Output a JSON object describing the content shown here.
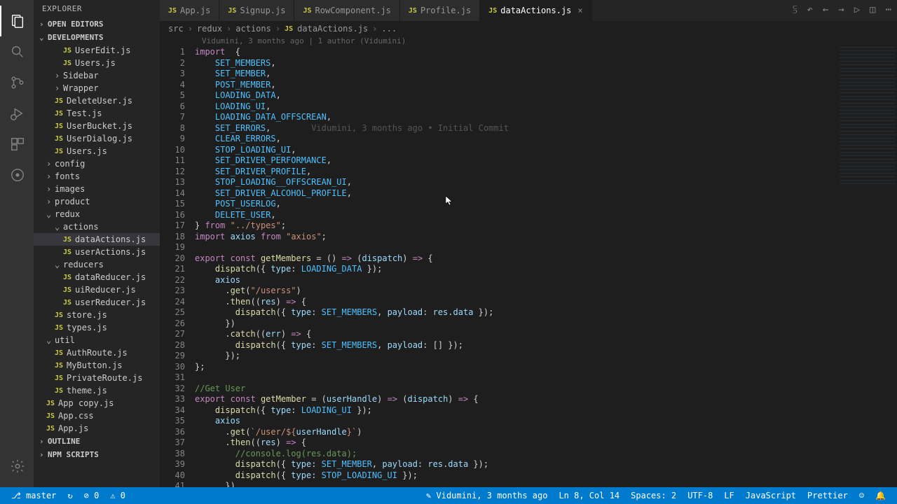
{
  "sidebar": {
    "title": "EXPLORER",
    "sections": {
      "openEditors": "OPEN EDITORS",
      "workspace": "DEVELOPMENTS",
      "outline": "OUTLINE",
      "npm": "NPM SCRIPTS"
    },
    "tree": [
      {
        "type": "file",
        "name": "UserEdit.js",
        "indent": 2
      },
      {
        "type": "file",
        "name": "Users.js",
        "indent": 2
      },
      {
        "type": "folder",
        "name": "Sidebar",
        "indent": 1,
        "open": false
      },
      {
        "type": "folder",
        "name": "Wrapper",
        "indent": 1,
        "open": false
      },
      {
        "type": "file",
        "name": "DeleteUser.js",
        "indent": 1
      },
      {
        "type": "file",
        "name": "Test.js",
        "indent": 1
      },
      {
        "type": "file",
        "name": "UserBucket.js",
        "indent": 1
      },
      {
        "type": "file",
        "name": "UserDialog.js",
        "indent": 1
      },
      {
        "type": "file",
        "name": "Users.js",
        "indent": 1
      },
      {
        "type": "folder",
        "name": "config",
        "indent": 0,
        "open": false
      },
      {
        "type": "folder",
        "name": "fonts",
        "indent": 0,
        "open": false
      },
      {
        "type": "folder",
        "name": "images",
        "indent": 0,
        "open": false
      },
      {
        "type": "folder",
        "name": "product",
        "indent": 0,
        "open": false
      },
      {
        "type": "folder",
        "name": "redux",
        "indent": 0,
        "open": true
      },
      {
        "type": "folder",
        "name": "actions",
        "indent": 1,
        "open": true
      },
      {
        "type": "file",
        "name": "dataActions.js",
        "indent": 2,
        "selected": true
      },
      {
        "type": "file",
        "name": "userActions.js",
        "indent": 2
      },
      {
        "type": "folder",
        "name": "reducers",
        "indent": 1,
        "open": true
      },
      {
        "type": "file",
        "name": "dataReducer.js",
        "indent": 2
      },
      {
        "type": "file",
        "name": "uiReducer.js",
        "indent": 2
      },
      {
        "type": "file",
        "name": "userReducer.js",
        "indent": 2
      },
      {
        "type": "file",
        "name": "store.js",
        "indent": 1
      },
      {
        "type": "file",
        "name": "types.js",
        "indent": 1
      },
      {
        "type": "folder",
        "name": "util",
        "indent": 0,
        "open": true
      },
      {
        "type": "file",
        "name": "AuthRoute.js",
        "indent": 1
      },
      {
        "type": "file",
        "name": "MyButton.js",
        "indent": 1
      },
      {
        "type": "file",
        "name": "PrivateRoute.js",
        "indent": 1
      },
      {
        "type": "file",
        "name": "theme.js",
        "indent": 1
      },
      {
        "type": "file",
        "name": "App copy.js",
        "indent": 0
      },
      {
        "type": "file",
        "name": "App.css",
        "indent": 0
      },
      {
        "type": "file",
        "name": "App.js",
        "indent": 0
      }
    ]
  },
  "tabs": [
    {
      "label": "App.js",
      "active": false
    },
    {
      "label": "Signup.js",
      "active": false
    },
    {
      "label": "RowComponent.js",
      "active": false
    },
    {
      "label": "Profile.js",
      "active": false
    },
    {
      "label": "dataActions.js",
      "active": true
    }
  ],
  "breadcrumb": [
    "src",
    "redux",
    "actions",
    "dataActions.js",
    "..."
  ],
  "blameHeader": "Vidumini, 3 months ago | 1 author (Vidumini)",
  "inlineBlame": "Vidumini, 3 months ago • Initial Commit",
  "code": {
    "lines": [
      [
        [
          "kw",
          "import"
        ],
        [
          "punct",
          "  {"
        ]
      ],
      [
        [
          "punct",
          "    "
        ],
        [
          "const-name",
          "SET_MEMBERS"
        ],
        [
          "punct",
          ","
        ]
      ],
      [
        [
          "punct",
          "    "
        ],
        [
          "const-name",
          "SET_MEMBER"
        ],
        [
          "punct",
          ","
        ]
      ],
      [
        [
          "punct",
          "    "
        ],
        [
          "const-name",
          "POST_MEMBER"
        ],
        [
          "punct",
          ","
        ]
      ],
      [
        [
          "punct",
          "    "
        ],
        [
          "const-name",
          "LOADING_DATA"
        ],
        [
          "punct",
          ","
        ]
      ],
      [
        [
          "punct",
          "    "
        ],
        [
          "const-name",
          "LOADING_UI"
        ],
        [
          "punct",
          ","
        ]
      ],
      [
        [
          "punct",
          "    "
        ],
        [
          "const-name",
          "LOADING_DATA_OFFSCREAN"
        ],
        [
          "punct",
          ","
        ]
      ],
      [
        [
          "punct",
          "    "
        ],
        [
          "const-name",
          "SET_ERRORS"
        ],
        [
          "punct",
          ","
        ],
        [
          "blame-inline",
          "        Vidumini, 3 months ago • Initial Commit"
        ]
      ],
      [
        [
          "punct",
          "    "
        ],
        [
          "const-name",
          "CLEAR_ERRORS"
        ],
        [
          "punct",
          ","
        ]
      ],
      [
        [
          "punct",
          "    "
        ],
        [
          "const-name",
          "STOP_LOADING_UI"
        ],
        [
          "punct",
          ","
        ]
      ],
      [
        [
          "punct",
          "    "
        ],
        [
          "const-name",
          "SET_DRIVER_PERFORMANCE"
        ],
        [
          "punct",
          ","
        ]
      ],
      [
        [
          "punct",
          "    "
        ],
        [
          "const-name",
          "SET_DRIVER_PROFILE"
        ],
        [
          "punct",
          ","
        ]
      ],
      [
        [
          "punct",
          "    "
        ],
        [
          "const-name",
          "STOP_LOADING__OFFSCREAN_UI"
        ],
        [
          "punct",
          ","
        ]
      ],
      [
        [
          "punct",
          "    "
        ],
        [
          "const-name",
          "SET_DRIVER_ALCOHOL_PROFILE"
        ],
        [
          "punct",
          ","
        ]
      ],
      [
        [
          "punct",
          "    "
        ],
        [
          "const-name",
          "POST_USERLOG"
        ],
        [
          "punct",
          ","
        ]
      ],
      [
        [
          "punct",
          "    "
        ],
        [
          "const-name",
          "DELETE_USER"
        ],
        [
          "punct",
          ","
        ]
      ],
      [
        [
          "punct",
          "} "
        ],
        [
          "kw",
          "from"
        ],
        [
          "punct",
          " "
        ],
        [
          "str",
          "\"../types\""
        ],
        [
          "punct",
          ";"
        ]
      ],
      [
        [
          "kw",
          "import"
        ],
        [
          "punct",
          " "
        ],
        [
          "var",
          "axios"
        ],
        [
          "punct",
          " "
        ],
        [
          "kw",
          "from"
        ],
        [
          "punct",
          " "
        ],
        [
          "str",
          "\"axios\""
        ],
        [
          "punct",
          ";"
        ]
      ],
      [
        [
          "punct",
          ""
        ]
      ],
      [
        [
          "kw",
          "export"
        ],
        [
          "punct",
          " "
        ],
        [
          "kw",
          "const"
        ],
        [
          "punct",
          " "
        ],
        [
          "fn",
          "getMembers"
        ],
        [
          "punct",
          " = () "
        ],
        [
          "kw",
          "=>"
        ],
        [
          "punct",
          " ("
        ],
        [
          "var",
          "dispatch"
        ],
        [
          "punct",
          ") "
        ],
        [
          "kw",
          "=>"
        ],
        [
          "punct",
          " {"
        ]
      ],
      [
        [
          "punct",
          "    "
        ],
        [
          "fn",
          "dispatch"
        ],
        [
          "punct",
          "({ "
        ],
        [
          "var",
          "type"
        ],
        [
          "punct",
          ": "
        ],
        [
          "const-name",
          "LOADING_DATA"
        ],
        [
          "punct",
          " });"
        ]
      ],
      [
        [
          "punct",
          "    "
        ],
        [
          "var",
          "axios"
        ]
      ],
      [
        [
          "punct",
          "      ."
        ],
        [
          "fn",
          "get"
        ],
        [
          "punct",
          "("
        ],
        [
          "str",
          "\"/userss\""
        ],
        [
          "punct",
          ")"
        ]
      ],
      [
        [
          "punct",
          "      ."
        ],
        [
          "fn",
          "then"
        ],
        [
          "punct",
          "(("
        ],
        [
          "var",
          "res"
        ],
        [
          "punct",
          ") "
        ],
        [
          "kw",
          "=>"
        ],
        [
          "punct",
          " {"
        ]
      ],
      [
        [
          "punct",
          "        "
        ],
        [
          "fn",
          "dispatch"
        ],
        [
          "punct",
          "({ "
        ],
        [
          "var",
          "type"
        ],
        [
          "punct",
          ": "
        ],
        [
          "const-name",
          "SET_MEMBERS"
        ],
        [
          "punct",
          ", "
        ],
        [
          "var",
          "payload"
        ],
        [
          "punct",
          ": "
        ],
        [
          "var",
          "res"
        ],
        [
          "punct",
          "."
        ],
        [
          "var",
          "data"
        ],
        [
          "punct",
          " });"
        ]
      ],
      [
        [
          "punct",
          "      })"
        ]
      ],
      [
        [
          "punct",
          "      ."
        ],
        [
          "fn",
          "catch"
        ],
        [
          "punct",
          "(("
        ],
        [
          "var",
          "err"
        ],
        [
          "punct",
          ") "
        ],
        [
          "kw",
          "=>"
        ],
        [
          "punct",
          " {"
        ]
      ],
      [
        [
          "punct",
          "        "
        ],
        [
          "fn",
          "dispatch"
        ],
        [
          "punct",
          "({ "
        ],
        [
          "var",
          "type"
        ],
        [
          "punct",
          ": "
        ],
        [
          "const-name",
          "SET_MEMBERS"
        ],
        [
          "punct",
          ", "
        ],
        [
          "var",
          "payload"
        ],
        [
          "punct",
          ": [] });"
        ]
      ],
      [
        [
          "punct",
          "      });"
        ]
      ],
      [
        [
          "punct",
          "};"
        ]
      ],
      [
        [
          "punct",
          ""
        ]
      ],
      [
        [
          "comment",
          "//Get User"
        ]
      ],
      [
        [
          "kw",
          "export"
        ],
        [
          "punct",
          " "
        ],
        [
          "kw",
          "const"
        ],
        [
          "punct",
          " "
        ],
        [
          "fn",
          "getMember"
        ],
        [
          "punct",
          " = ("
        ],
        [
          "var",
          "userHandle"
        ],
        [
          "punct",
          ") "
        ],
        [
          "kw",
          "=>"
        ],
        [
          "punct",
          " ("
        ],
        [
          "var",
          "dispatch"
        ],
        [
          "punct",
          ") "
        ],
        [
          "kw",
          "=>"
        ],
        [
          "punct",
          " {"
        ]
      ],
      [
        [
          "punct",
          "    "
        ],
        [
          "fn",
          "dispatch"
        ],
        [
          "punct",
          "({ "
        ],
        [
          "var",
          "type"
        ],
        [
          "punct",
          ": "
        ],
        [
          "const-name",
          "LOADING_UI"
        ],
        [
          "punct",
          " });"
        ]
      ],
      [
        [
          "punct",
          "    "
        ],
        [
          "var",
          "axios"
        ]
      ],
      [
        [
          "punct",
          "      ."
        ],
        [
          "fn",
          "get"
        ],
        [
          "punct",
          "("
        ],
        [
          "str",
          "`/user/${"
        ],
        [
          "var",
          "userHandle"
        ],
        [
          "str",
          "}`"
        ],
        [
          "punct",
          ")"
        ]
      ],
      [
        [
          "punct",
          "      ."
        ],
        [
          "fn",
          "then"
        ],
        [
          "punct",
          "(("
        ],
        [
          "var",
          "res"
        ],
        [
          "punct",
          ") "
        ],
        [
          "kw",
          "=>"
        ],
        [
          "punct",
          " {"
        ]
      ],
      [
        [
          "punct",
          "        "
        ],
        [
          "comment",
          "//console.log(res.data);"
        ]
      ],
      [
        [
          "punct",
          "        "
        ],
        [
          "fn",
          "dispatch"
        ],
        [
          "punct",
          "({ "
        ],
        [
          "var",
          "type"
        ],
        [
          "punct",
          ": "
        ],
        [
          "const-name",
          "SET_MEMBER"
        ],
        [
          "punct",
          ", "
        ],
        [
          "var",
          "payload"
        ],
        [
          "punct",
          ": "
        ],
        [
          "var",
          "res"
        ],
        [
          "punct",
          "."
        ],
        [
          "var",
          "data"
        ],
        [
          "punct",
          " });"
        ]
      ],
      [
        [
          "punct",
          "        "
        ],
        [
          "fn",
          "dispatch"
        ],
        [
          "punct",
          "({ "
        ],
        [
          "var",
          "type"
        ],
        [
          "punct",
          ": "
        ],
        [
          "const-name",
          "STOP_LOADING_UI"
        ],
        [
          "punct",
          " });"
        ]
      ],
      [
        [
          "punct",
          "      })"
        ]
      ]
    ],
    "firstLine": 1
  },
  "statusbar": {
    "branch": "master",
    "sync": "↻",
    "errors": "⊘ 0",
    "warnings": "⚠ 0",
    "blame": "Vidumini, 3 months ago",
    "cursor": "Ln 8, Col 14",
    "spaces": "Spaces: 2",
    "encoding": "UTF-8",
    "eol": "LF",
    "language": "JavaScript",
    "formatter": "Prettier",
    "feedback": "☺",
    "bell": "🔔"
  }
}
